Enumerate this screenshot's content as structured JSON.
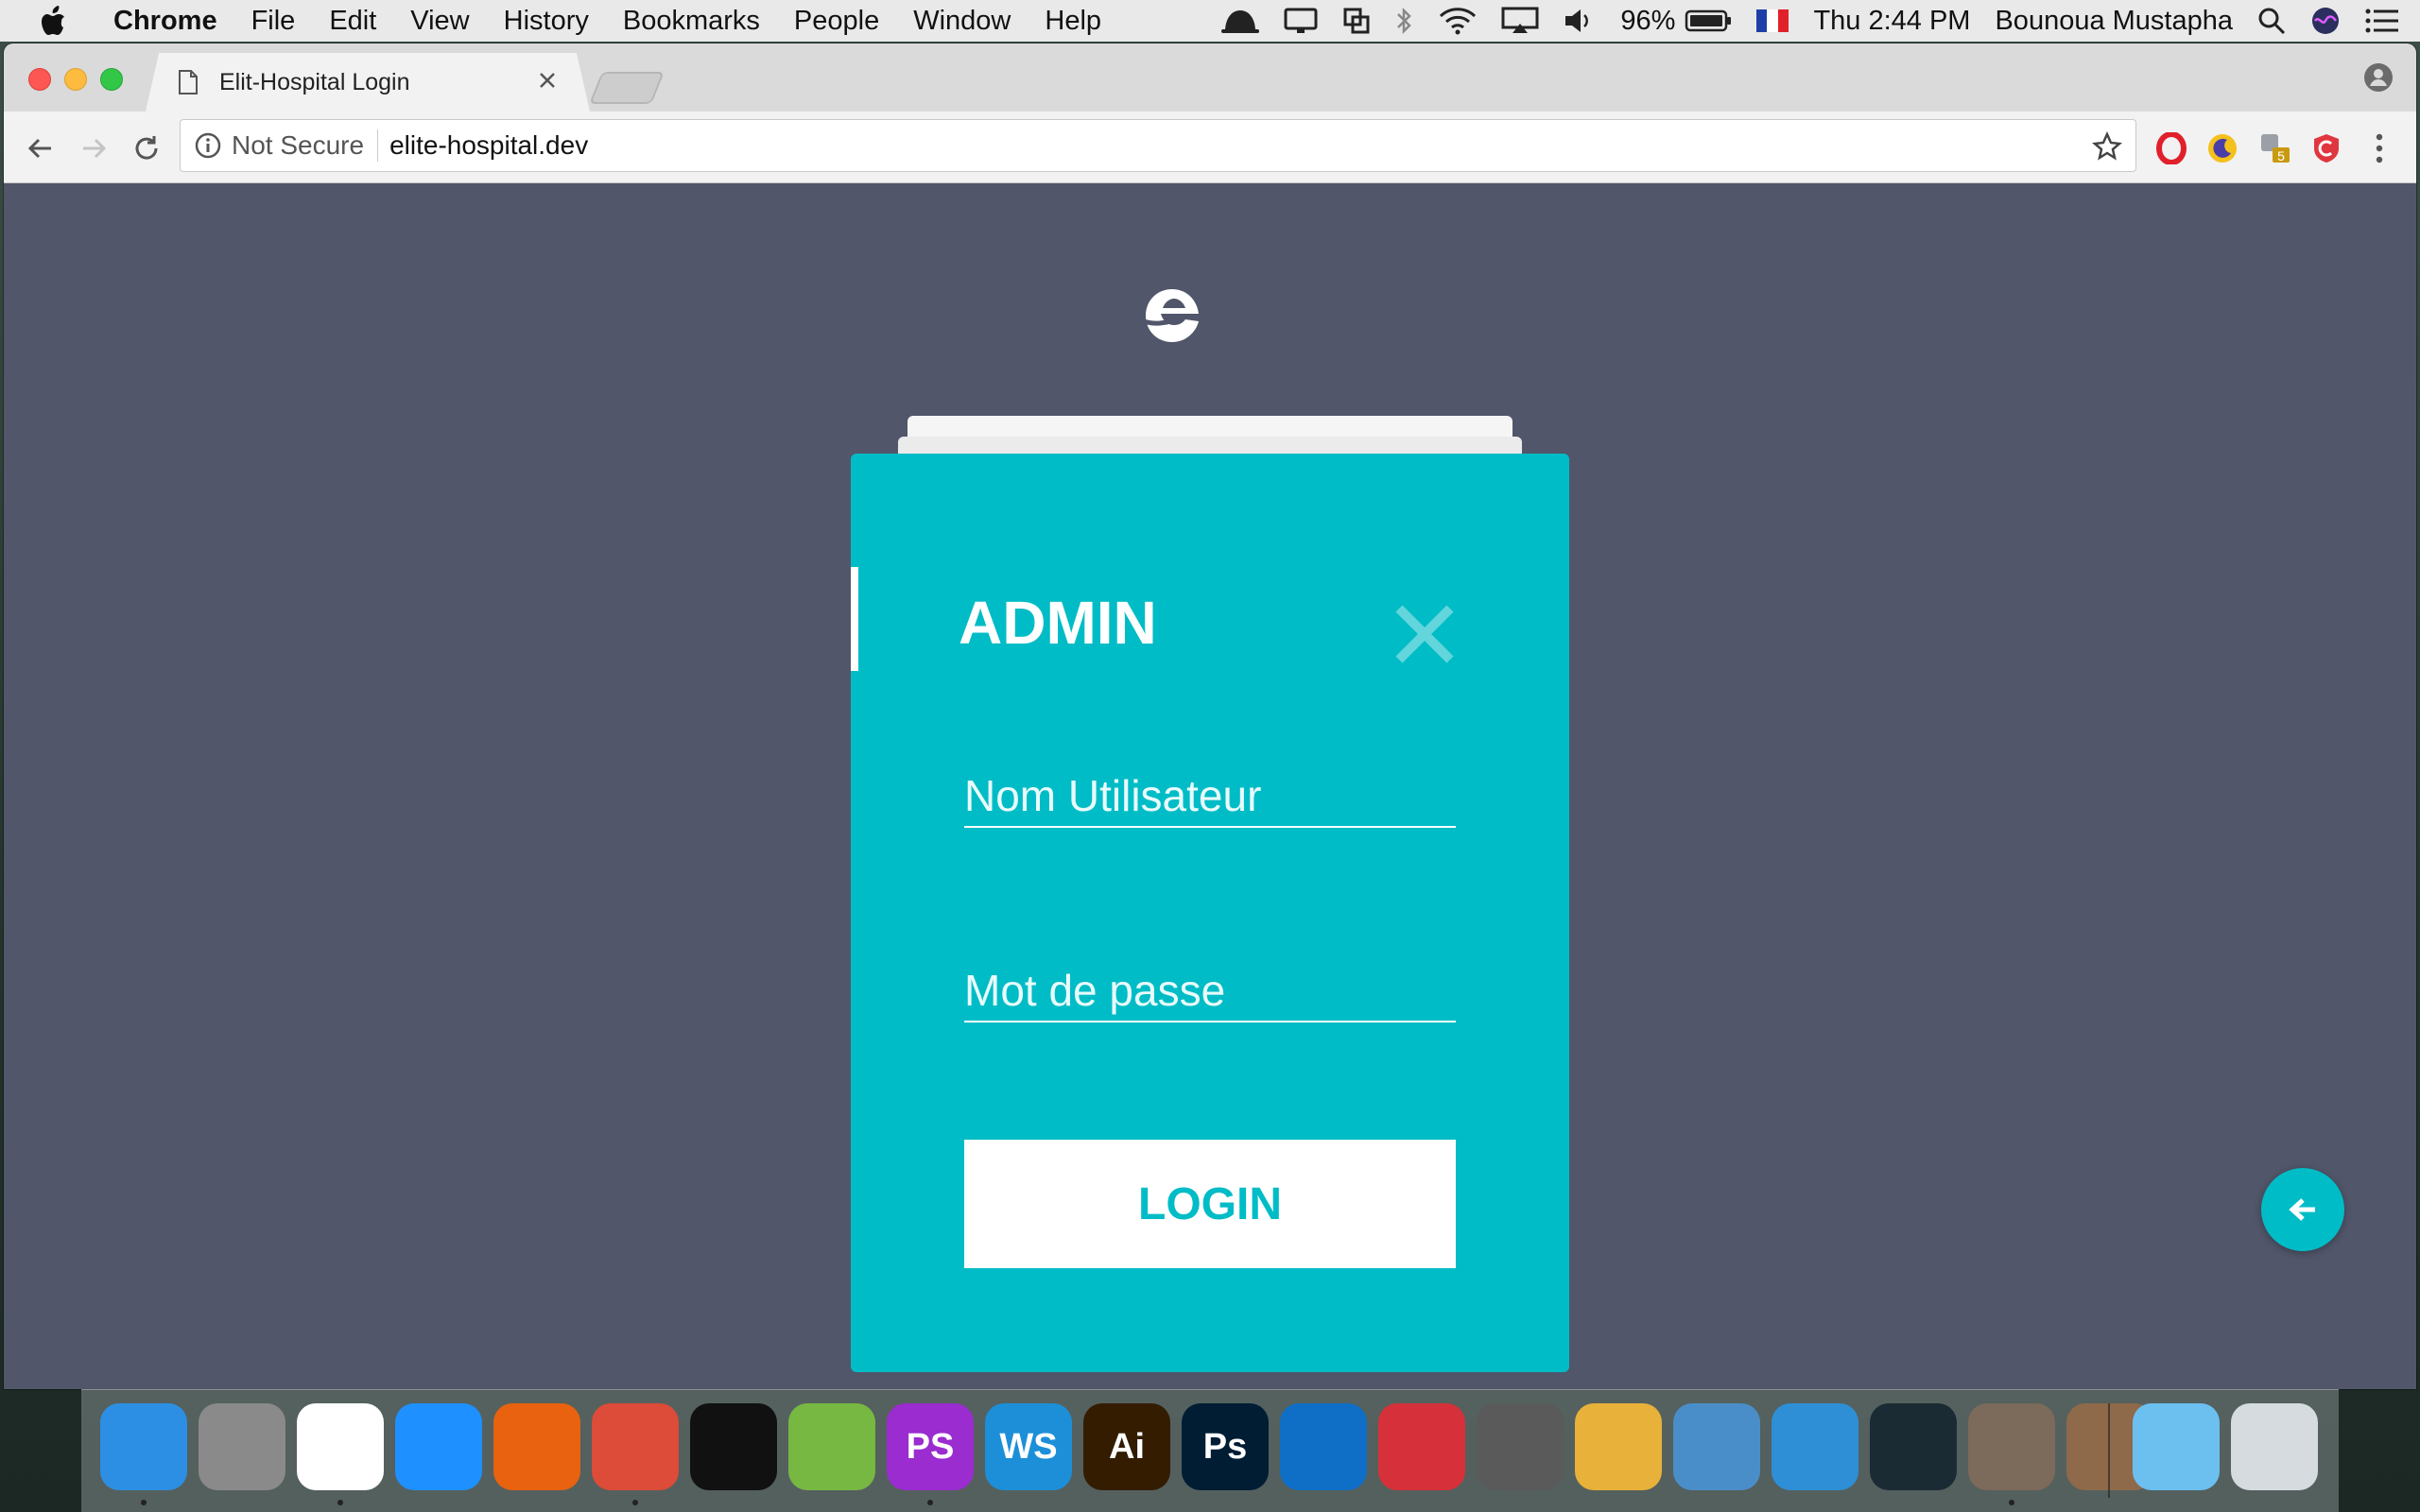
{
  "menubar": {
    "app_name": "Chrome",
    "items": [
      "File",
      "Edit",
      "View",
      "History",
      "Bookmarks",
      "People",
      "Window",
      "Help"
    ],
    "battery": "96%",
    "clock": "Thu 2:44 PM",
    "user": "Bounoua Mustapha",
    "status_icons": [
      "ghost-icon",
      "display-icon",
      "screens-icon",
      "bluetooth-icon",
      "wifi-icon",
      "airplay-icon",
      "volume-icon",
      "battery-icon",
      "flag-france-icon"
    ]
  },
  "browser": {
    "tab_title": "Elit-Hospital Login",
    "security_label": "Not Secure",
    "url": "elite-hospital.dev",
    "extensions": [
      "opera-vpn-icon",
      "night-mode-icon",
      "extension-badge-icon",
      "red-shield-icon"
    ],
    "extension_badge": "5"
  },
  "login": {
    "title": "ADMIN",
    "username_placeholder": "Nom Utilisateur",
    "password_placeholder": "Mot de passe",
    "login_label": "LOGIN"
  },
  "colors": {
    "page_background": "#51566a",
    "card_accent": "#00bcc6",
    "text_on_card": "#ffffff"
  },
  "dock": {
    "apps": [
      {
        "name": "finder",
        "label": "",
        "color": "#2d8fe3"
      },
      {
        "name": "system-preferences",
        "label": "",
        "color": "#8a8a8a"
      },
      {
        "name": "migrate",
        "label": "",
        "color": "#ffffff"
      },
      {
        "name": "safari",
        "label": "",
        "color": "#1e90ff"
      },
      {
        "name": "firefox",
        "label": "",
        "color": "#e8620f"
      },
      {
        "name": "chrome",
        "label": "",
        "color": "#dd4b39"
      },
      {
        "name": "terminal",
        "label": "",
        "color": "#111111"
      },
      {
        "name": "android-studio",
        "label": "",
        "color": "#77b843"
      },
      {
        "name": "phpstorm",
        "label": "PS",
        "color": "#9a2cd0"
      },
      {
        "name": "webstorm",
        "label": "WS",
        "color": "#1d8fd8"
      },
      {
        "name": "illustrator",
        "label": "Ai",
        "color": "#331c00"
      },
      {
        "name": "photoshop",
        "label": "Ps",
        "color": "#001d34"
      },
      {
        "name": "visual-studio-code",
        "label": "",
        "color": "#0f6fc6"
      },
      {
        "name": "bitbucket-sourcetree",
        "label": "",
        "color": "#d6313a"
      },
      {
        "name": "tableplus",
        "label": "",
        "color": "#5a5a5a"
      },
      {
        "name": "sequel-pro",
        "label": "",
        "color": "#e8b13a"
      },
      {
        "name": "sublime",
        "label": "",
        "color": "#4a8ec9"
      },
      {
        "name": "parallels",
        "label": "",
        "color": "#2e8fd6"
      },
      {
        "name": "gitkraken",
        "label": "",
        "color": "#1b2b34"
      },
      {
        "name": "app-shell",
        "label": "",
        "color": "#7c6a5a"
      },
      {
        "name": "downloads-stack",
        "label": "",
        "color": "#8e6a4a"
      },
      {
        "name": "folder",
        "label": "",
        "color": "#6bc0f0"
      },
      {
        "name": "trash",
        "label": "",
        "color": "#d6dbe0"
      }
    ]
  }
}
